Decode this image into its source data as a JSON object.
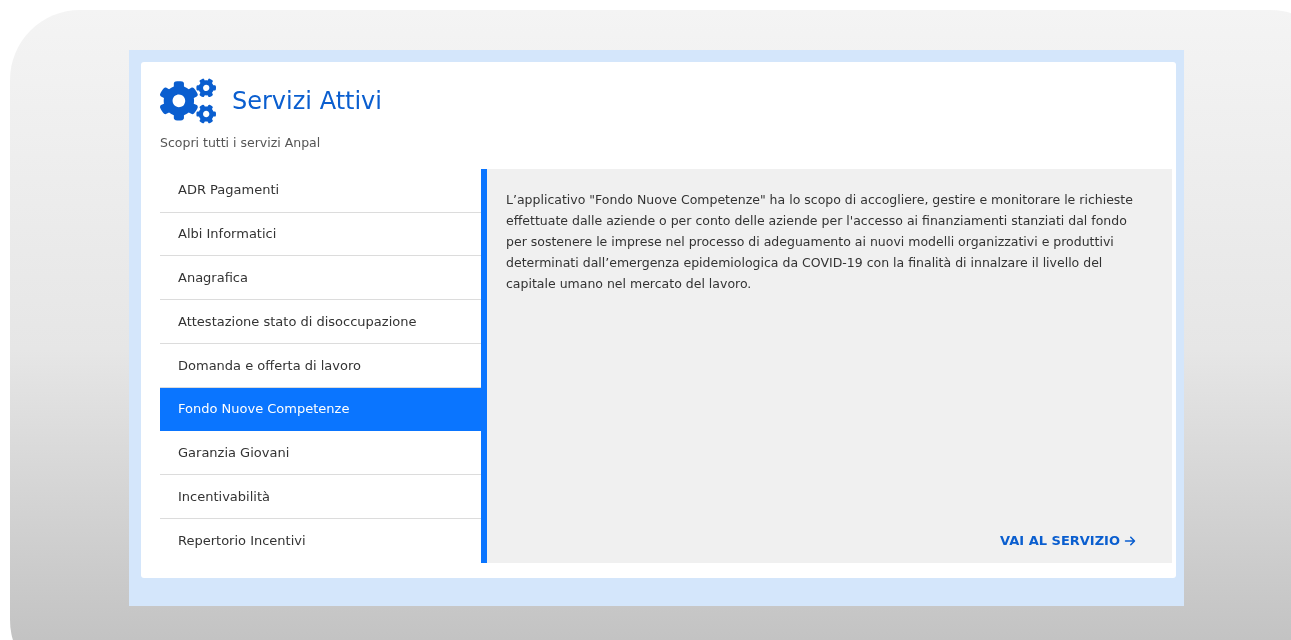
{
  "header": {
    "title": "Servizi Attivi",
    "subtitle": "Scopri tutti i servizi Anpal"
  },
  "services": [
    {
      "label": "ADR Pagamenti",
      "selected": false
    },
    {
      "label": "Albi Informatici",
      "selected": false
    },
    {
      "label": "Anagrafica",
      "selected": false
    },
    {
      "label": "Attestazione stato di disoccupazione",
      "selected": false
    },
    {
      "label": "Domanda e offerta di lavoro",
      "selected": false
    },
    {
      "label": "Fondo Nuove Competenze",
      "selected": true
    },
    {
      "label": "Garanzia Giovani",
      "selected": false
    },
    {
      "label": "Incentivabilità",
      "selected": false
    },
    {
      "label": "Repertorio Incentivi",
      "selected": false
    }
  ],
  "detail": {
    "description": "L’applicativo \"Fondo Nuove Competenze\" ha lo scopo di accogliere, gestire e monitorare le richieste effettuate dalle aziende o per conto delle aziende per l'accesso ai finanziamenti stanziati dal fondo per sostenere le imprese nel processo di adeguamento ai nuovi modelli organizzativi e produttivi determinati dall’emergenza epidemiologica da COVID-19 con la finalità di innalzare il livello del capitale umano nel mercato del lavoro.",
    "link": "VAI AL SERVIZIO"
  }
}
